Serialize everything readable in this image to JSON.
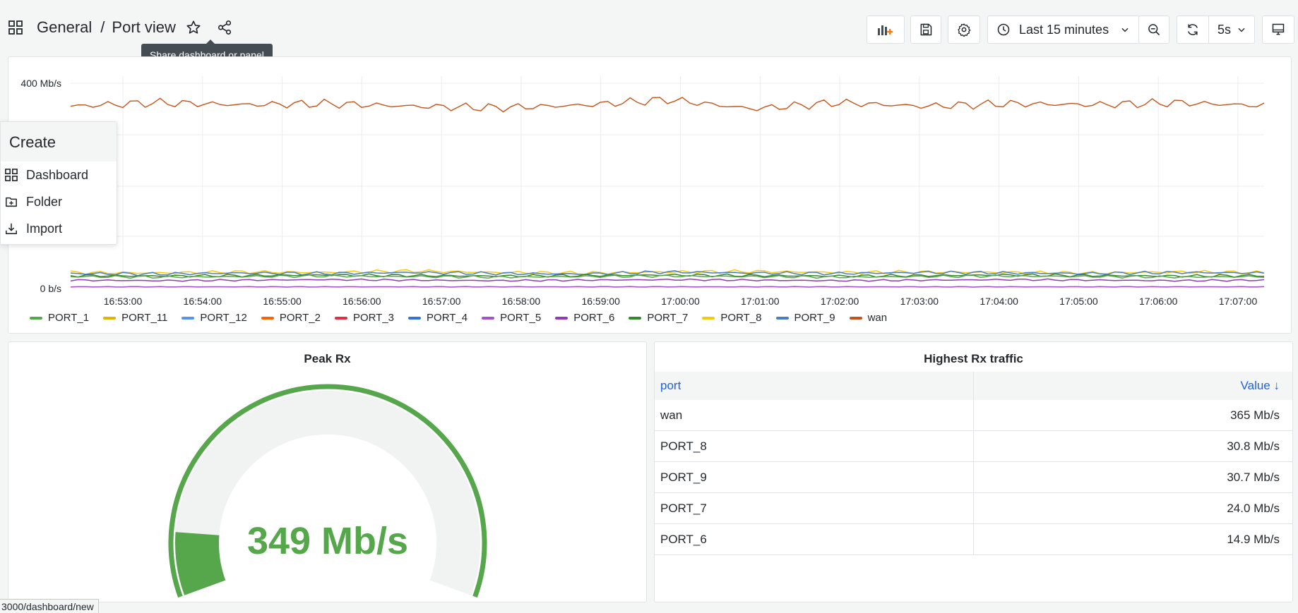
{
  "header": {
    "folder": "General",
    "separator": "/",
    "dashboard": "Port view",
    "tooltip": "Share dashboard or panel",
    "time_range": "Last 15 minutes",
    "refresh_interval": "5s"
  },
  "create_menu": {
    "title": "Create",
    "items": [
      "Dashboard",
      "Folder",
      "Import"
    ]
  },
  "timeseries": {
    "y_ticks": [
      "400 Mb/s",
      "0 b/s"
    ],
    "x_ticks": [
      "16:53:00",
      "16:54:00",
      "16:55:00",
      "16:56:00",
      "16:57:00",
      "16:58:00",
      "16:59:00",
      "17:00:00",
      "17:01:00",
      "17:02:00",
      "17:03:00",
      "17:04:00",
      "17:05:00",
      "17:06:00",
      "17:07:00"
    ],
    "legend": [
      {
        "name": "PORT_1",
        "color": "#56a64b"
      },
      {
        "name": "PORT_11",
        "color": "#e0b400"
      },
      {
        "name": "PORT_12",
        "color": "#5794f2"
      },
      {
        "name": "PORT_2",
        "color": "#fa6400"
      },
      {
        "name": "PORT_3",
        "color": "#e02f44"
      },
      {
        "name": "PORT_4",
        "color": "#3274d9"
      },
      {
        "name": "PORT_5",
        "color": "#a352cc"
      },
      {
        "name": "PORT_6",
        "color": "#8f3bb8"
      },
      {
        "name": "PORT_7",
        "color": "#37872d"
      },
      {
        "name": "PORT_8",
        "color": "#f2cc0c"
      },
      {
        "name": "PORT_9",
        "color": "#4a7dc4"
      },
      {
        "name": "wan",
        "color": "#c4541a"
      }
    ]
  },
  "chart_data": {
    "type": "line",
    "x": [
      "16:53:00",
      "16:54:00",
      "16:55:00",
      "16:56:00",
      "16:57:00",
      "16:58:00",
      "16:59:00",
      "17:00:00",
      "17:01:00",
      "17:02:00",
      "17:03:00",
      "17:04:00",
      "17:05:00",
      "17:06:00",
      "17:07:00"
    ],
    "ylim": [
      0,
      400
    ],
    "yunit": "Mb/s",
    "series": [
      {
        "name": "wan",
        "values": [
          355,
          362,
          358,
          360,
          355,
          352,
          357,
          368,
          350,
          362,
          355,
          360,
          358,
          362,
          356
        ]
      },
      {
        "name": "PORT_8",
        "values": [
          30,
          29,
          31,
          30,
          33,
          30,
          29,
          31,
          32,
          30,
          31,
          30,
          29,
          31,
          30
        ]
      },
      {
        "name": "PORT_9",
        "values": [
          28,
          27,
          29,
          28,
          30,
          28,
          27,
          31,
          29,
          28,
          30,
          29,
          28,
          30,
          29
        ]
      },
      {
        "name": "PORT_7",
        "values": [
          24,
          23,
          24,
          25,
          24,
          23,
          24,
          25,
          24,
          23,
          24,
          25,
          24,
          23,
          24
        ]
      },
      {
        "name": "PORT_1",
        "values": [
          22,
          21,
          22,
          23,
          22,
          21,
          22,
          23,
          22,
          21,
          22,
          23,
          22,
          21,
          22
        ]
      },
      {
        "name": "PORT_6",
        "values": [
          15,
          14,
          15,
          16,
          15,
          14,
          15,
          16,
          15,
          14,
          15,
          16,
          15,
          14,
          15
        ]
      },
      {
        "name": "PORT_5",
        "values": [
          2,
          2,
          2,
          2,
          2,
          2,
          2,
          2,
          2,
          2,
          2,
          2,
          2,
          2,
          2
        ]
      }
    ]
  },
  "gauge": {
    "title": "Peak Rx",
    "value_text": "349 Mb/s",
    "value": 349,
    "fraction": 0.11
  },
  "table": {
    "title": "Highest Rx traffic",
    "headers": [
      "port",
      "Value ↓"
    ],
    "rows": [
      [
        "wan",
        "365 Mb/s"
      ],
      [
        "PORT_8",
        "30.8 Mb/s"
      ],
      [
        "PORT_9",
        "30.7 Mb/s"
      ],
      [
        "PORT_7",
        "24.0 Mb/s"
      ],
      [
        "PORT_6",
        "14.9 Mb/s"
      ]
    ]
  },
  "status_url": "3000/dashboard/new"
}
